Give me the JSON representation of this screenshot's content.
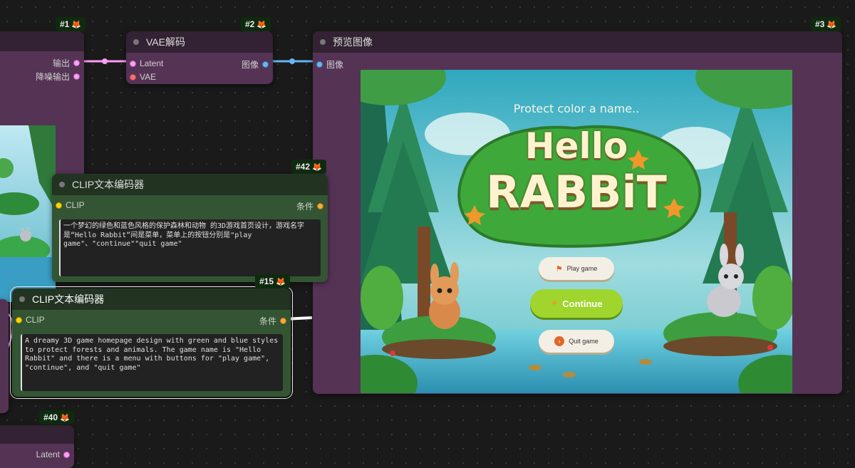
{
  "nodes": {
    "n1": {
      "badge": "#1",
      "outputs": [
        "输出",
        "降噪输出"
      ]
    },
    "n2": {
      "badge": "#2",
      "title": "VAE解码",
      "inputs": [
        "Latent",
        "VAE"
      ],
      "output": "图像"
    },
    "n3": {
      "badge": "#3",
      "title": "预览图像",
      "input": "图像"
    },
    "n42": {
      "badge": "#42",
      "title": "CLIP文本编码器",
      "input": "CLIP",
      "output": "条件",
      "text": "一个梦幻的绿色和蓝色风格的保护森林和动物 的3D游戏首页设计，游戏名字是“Hello Rabbit”间是菜单，菜单上的按钮分别是\"play game\"、\"continue\"\"quit game\""
    },
    "n15": {
      "badge": "#15",
      "title": "CLIP文本编码器",
      "input": "CLIP",
      "output": "条件",
      "text": "A dreamy 3D game homepage design with green and blue styles to protect forests and animals. The game name is \"Hello Rabbit\" and there is a menu with buttons for \"play game\", \"continue\", and \"quit game\""
    },
    "n40": {
      "badge": "#40",
      "output": "Latent"
    }
  },
  "preview": {
    "subtitle": "Protect color a name..",
    "title_line1": "Hello",
    "title_line2": "RABBiT",
    "buttons": [
      "Play game",
      "Continue",
      "Quit game"
    ]
  },
  "colors": {
    "latent": "#ff9cf9",
    "vae": "#ff6e6e",
    "image": "#64b5f6",
    "clip": "#ffd500",
    "conditioning": "#ffa931"
  }
}
